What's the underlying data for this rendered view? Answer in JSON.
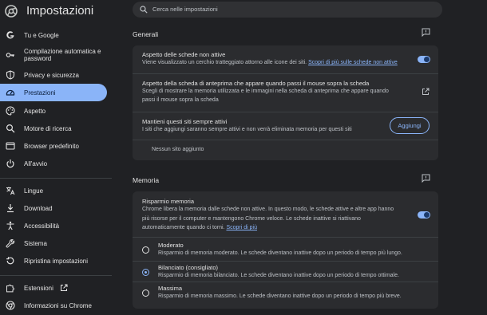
{
  "app": {
    "title": "Impostazioni"
  },
  "search": {
    "placeholder": "Cerca nelle impostazioni"
  },
  "sidebar": {
    "items": [
      {
        "label": "Tu e Google",
        "icon": "google-g-icon"
      },
      {
        "label": "Compilazione automatica e password",
        "icon": "key-icon"
      },
      {
        "label": "Privacy e sicurezza",
        "icon": "shield-icon"
      },
      {
        "label": "Prestazioni",
        "icon": "speedometer-icon",
        "active": true
      },
      {
        "label": "Aspetto",
        "icon": "palette-icon"
      },
      {
        "label": "Motore di ricerca",
        "icon": "search-icon"
      },
      {
        "label": "Browser predefinito",
        "icon": "browser-window-icon"
      },
      {
        "label": "All'avvio",
        "icon": "power-icon"
      },
      {
        "label": "Lingue",
        "icon": "translate-icon"
      },
      {
        "label": "Download",
        "icon": "download-icon"
      },
      {
        "label": "Accessibilità",
        "icon": "accessibility-icon"
      },
      {
        "label": "Sistema",
        "icon": "wrench-icon"
      },
      {
        "label": "Ripristina impostazioni",
        "icon": "reset-icon"
      },
      {
        "label": "Estensioni",
        "icon": "puzzle-icon"
      },
      {
        "label": "Informazioni su Chrome",
        "icon": "chrome-icon"
      }
    ]
  },
  "generali": {
    "title": "Generali",
    "inactive_tabs": {
      "title": "Aspetto delle schede non attive",
      "desc": "Viene visualizzato un cerchio tratteggiato attorno alle icone dei siti.",
      "link": "Scopri di più sulle schede non attive",
      "enabled": true
    },
    "hover_preview": {
      "title": "Aspetto della scheda di anteprima che appare quando passi il mouse sopra la scheda",
      "desc_line1": "Scegli di mostrare la memoria utilizzata e le immagini nella scheda di anteprima che appare quando",
      "desc_line2": "passi il mouse sopra la scheda"
    },
    "always_active": {
      "title": "Mantieni questi siti sempre attivi",
      "desc": "I siti che aggiungi saranno sempre attivi e non verrà eliminata memoria per questi siti",
      "button": "Aggiungi",
      "empty": "Nessun sito aggiunto"
    }
  },
  "memoria": {
    "title": "Memoria",
    "saver": {
      "title": "Risparmio memoria",
      "desc_line1": "Chrome libera la memoria dalle schede non attive. In questo modo, le schede attive e altre app hanno",
      "desc_line2": "più risorse per il computer e mantengono Chrome veloce. Le schede inattive si riattivano",
      "desc_line3": "automaticamente quando ci torni.",
      "link": "Scopri di più",
      "enabled": true
    },
    "options": [
      {
        "title": "Moderato",
        "desc": "Risparmio di memoria moderato. Le schede diventano inattive dopo un periodo di tempo più lungo.",
        "selected": false
      },
      {
        "title": "Bilanciato (consigliato)",
        "desc": "Risparmio di memoria bilanciato. Le schede diventano inattive dopo un periodo di tempo ottimale.",
        "selected": true
      },
      {
        "title": "Massima",
        "desc": "Risparmio di memoria massimo. Le schede diventano inattive dopo un periodo di tempo più breve.",
        "selected": false
      }
    ]
  }
}
